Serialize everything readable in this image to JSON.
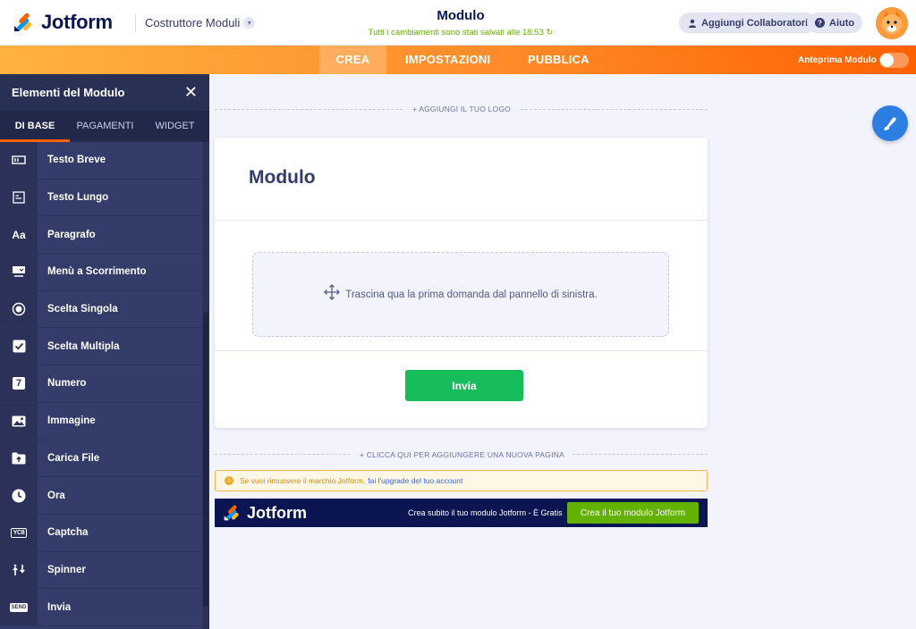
{
  "header": {
    "brand": "Jotform",
    "builder_menu": "Costruttore Moduli",
    "form_title": "Modulo",
    "save_status": "Tutti i cambiamenti sono stati salvati alle 18:53",
    "collaborators_button": "Aggiungi Collaboratori",
    "help_button": "Aiuto"
  },
  "nav": {
    "tabs": [
      {
        "label": "CREA",
        "active": true
      },
      {
        "label": "IMPOSTAZIONI",
        "active": false
      },
      {
        "label": "PUBBLICA",
        "active": false
      }
    ],
    "preview_label": "Anteprima Modulo",
    "preview_enabled": false
  },
  "sidebar": {
    "title": "Elementi del Modulo",
    "tabs": [
      {
        "label": "DI BASE",
        "active": true
      },
      {
        "label": "PAGAMENTI",
        "active": false
      },
      {
        "label": "WIDGET",
        "active": false
      }
    ],
    "items": [
      {
        "label": "Testo Breve",
        "icon": "short-text-icon"
      },
      {
        "label": "Testo Lungo",
        "icon": "long-text-icon"
      },
      {
        "label": "Paragrafo",
        "icon": "paragraph-icon"
      },
      {
        "label": "Menù a Scorrimento",
        "icon": "dropdown-icon"
      },
      {
        "label": "Scelta Singola",
        "icon": "radio-icon"
      },
      {
        "label": "Scelta Multipla",
        "icon": "checkbox-icon"
      },
      {
        "label": "Numero",
        "icon": "number-icon"
      },
      {
        "label": "Immagine",
        "icon": "image-icon"
      },
      {
        "label": "Carica File",
        "icon": "upload-icon"
      },
      {
        "label": "Ora",
        "icon": "clock-icon"
      },
      {
        "label": "Captcha",
        "icon": "captcha-icon"
      },
      {
        "label": "Spinner",
        "icon": "spinner-icon"
      },
      {
        "label": "Invia",
        "icon": "send-icon"
      }
    ],
    "paragraph_glyph": "Aa",
    "number_glyph": "7",
    "send_glyph": "SEND",
    "captcha_glyph": "YC8"
  },
  "canvas": {
    "add_logo": "+ AGGIUNGI IL TUO LOGO",
    "form_heading": "Modulo",
    "dropzone_text": "Trascina qua la prima domanda dal pannello di sinistra.",
    "submit_label": "Invia",
    "add_page": "+ CLICCA QUI PER AGGIUNGERE UNA NUOVA PAGINA",
    "notice_text": "Se vuoi rimuovere il marchio Jotform,",
    "notice_link": "fai l'upgrade del tuo account",
    "promo_brand": "Jotform",
    "promo_text": "Crea subito il tuo modulo Jotform - È Gratis",
    "promo_button": "Crea il tuo modulo Jotform"
  },
  "colors": {
    "accent": "#ff6100",
    "sidebar": "#343c6a",
    "submit": "#18bd5b",
    "promo_button": "#64b200",
    "save_status": "#64b200"
  }
}
